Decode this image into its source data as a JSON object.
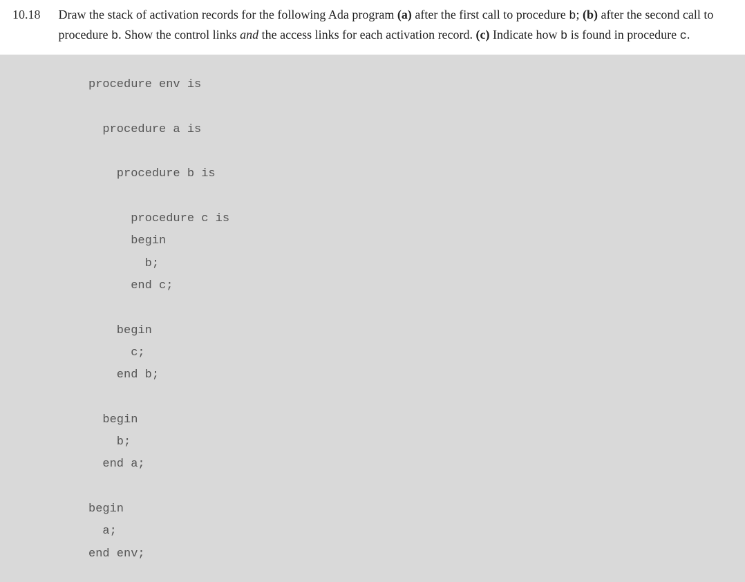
{
  "question": {
    "number": "10.18",
    "text_part1": "Draw the stack of activation records for the following Ada program ",
    "bold_a": "(a)",
    "text_part2": " after the first call to procedure ",
    "mono_b1": "b",
    "text_part3": "; ",
    "bold_b": "(b)",
    "text_part4": " after the second call to procedure ",
    "mono_b2": "b",
    "text_part5": ". Show the control links ",
    "italic_and": "and",
    "text_part6": " the access links for each activation record. ",
    "bold_c": "(c)",
    "text_part7": " Indicate how ",
    "mono_b3": "b",
    "text_part8": " is found in procedure ",
    "mono_c": "c",
    "text_part9": "."
  },
  "code": "procedure env is\n\n  procedure a is\n\n    procedure b is\n\n      procedure c is\n      begin\n        b;\n      end c;\n\n    begin\n      c;\n    end b;\n\n  begin\n    b;\n  end a;\n\nbegin\n  a;\nend env;"
}
